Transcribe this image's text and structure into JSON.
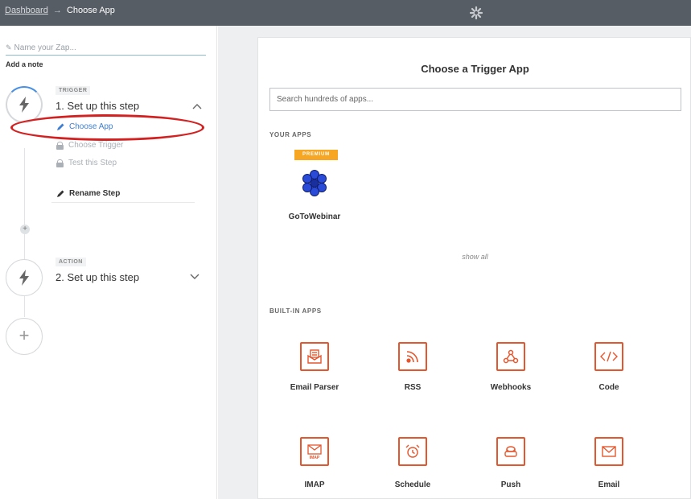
{
  "topbar": {
    "breadcrumb_parent": "Dashboard",
    "breadcrumb_separator": "→",
    "breadcrumb_current": "Choose App",
    "logo_icon": "zapier-asterisk-icon"
  },
  "sidebar": {
    "zap_name_placeholder": "Name your Zap...",
    "add_note": "Add a note",
    "trigger": {
      "type_label": "TRIGGER",
      "title": "1. Set up this step",
      "substeps": [
        {
          "label": "Choose App",
          "state": "active",
          "icon": "pencil-icon"
        },
        {
          "label": "Choose Trigger",
          "state": "locked",
          "icon": "lock-icon"
        },
        {
          "label": "Test this Step",
          "state": "locked",
          "icon": "lock-icon"
        }
      ],
      "rename": "Rename Step"
    },
    "action": {
      "type_label": "ACTION",
      "title": "2. Set up this step"
    }
  },
  "main": {
    "title": "Choose a Trigger App",
    "search_placeholder": "Search hundreds of apps...",
    "your_apps_label": "YOUR APPS",
    "your_apps": [
      {
        "name": "GoToWebinar",
        "badge": "PREMIUM"
      }
    ],
    "show_all": "show all",
    "built_in_label": "BUILT-IN APPS",
    "built_in_apps": [
      {
        "name": "Email Parser",
        "icon": "email-parser-icon"
      },
      {
        "name": "RSS",
        "icon": "rss-icon"
      },
      {
        "name": "Webhooks",
        "icon": "webhooks-icon"
      },
      {
        "name": "Code",
        "icon": "code-icon"
      },
      {
        "name": "IMAP",
        "icon": "imap-icon"
      },
      {
        "name": "Schedule",
        "icon": "alarm-clock-icon"
      },
      {
        "name": "Push",
        "icon": "push-button-icon"
      },
      {
        "name": "Email",
        "icon": "envelope-icon"
      }
    ]
  },
  "colors": {
    "topbar": "#575d65",
    "accent_blue": "#3f7fd0",
    "builtin_orange": "#e4572e",
    "premium": "#f6a623",
    "highlight_red": "#d32020"
  }
}
